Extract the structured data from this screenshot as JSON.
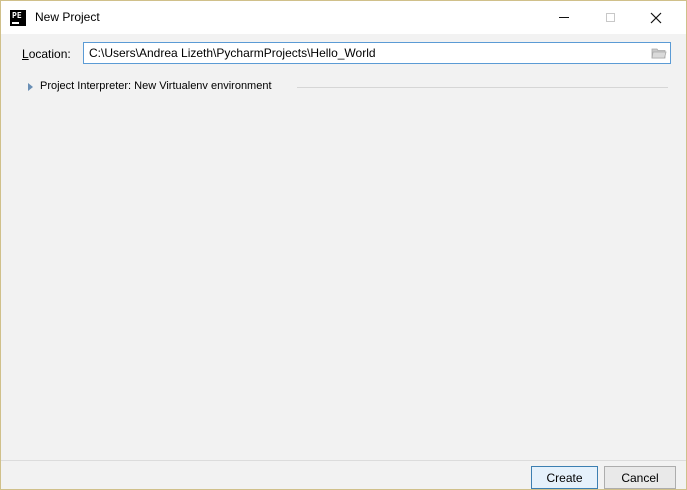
{
  "window": {
    "title": "New Project",
    "app_icon_text": "PE",
    "controls": {
      "minimize": "minimize-icon",
      "maximize": "maximize-icon",
      "close": "×"
    }
  },
  "location": {
    "label_accel": "L",
    "label_rest": "ocation:",
    "value": "C:\\Users\\Andrea Lizeth\\PycharmProjects\\Hello_World",
    "browse_icon": "folder-icon"
  },
  "interpreter": {
    "label": "Project Interpreter: New Virtualenv environment",
    "expanded": false
  },
  "buttons": {
    "create": "Create",
    "cancel": "Cancel"
  },
  "colors": {
    "accent": "#5b9bd5",
    "background": "#f2f2f2"
  }
}
